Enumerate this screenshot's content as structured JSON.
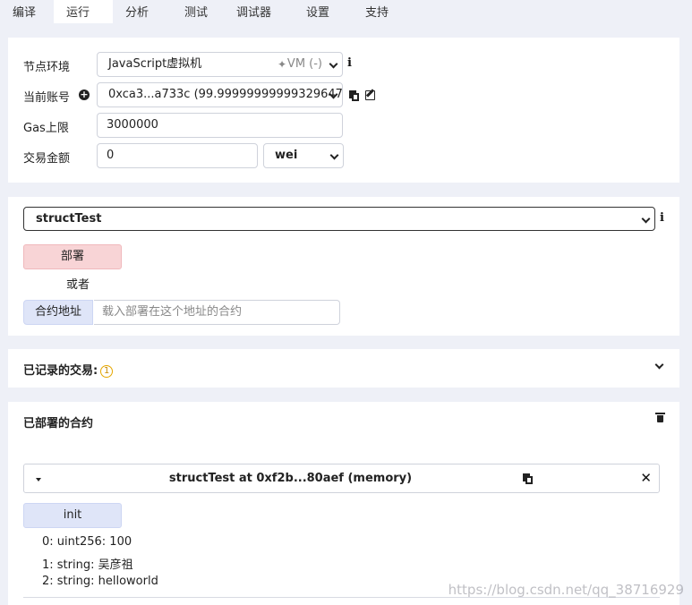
{
  "tabs": [
    "编译",
    "运行",
    "分析",
    "测试",
    "调试器",
    "设置",
    "支持"
  ],
  "environment": {
    "label": "节点环境",
    "value": "JavaScript虚拟机",
    "vm_tag": "VM (-)"
  },
  "account": {
    "label": "当前账号",
    "value": "0xca3...a733c (99.99999999999329647"
  },
  "gas": {
    "label": "Gas上限",
    "value": "3000000"
  },
  "tx_value": {
    "label": "交易金额",
    "value": "0",
    "unit": "wei"
  },
  "contract_select": {
    "value": "structTest"
  },
  "deploy": {
    "button": "部署",
    "or": "或者",
    "at_address_button": "合约地址",
    "at_address_placeholder": "载入部署在这个地址的合约"
  },
  "recorded": {
    "label": "已记录的交易:",
    "count": "1"
  },
  "deployed": {
    "title": "已部署的合约",
    "instance_title": "structTest at 0xf2b...80aef (memory)",
    "method_button": "init",
    "outputs": [
      "0: uint256: 100",
      "1: string: 吴彦祖",
      "2: string: helloworld"
    ]
  },
  "watermark": "https://blog.csdn.net/qq_38716929"
}
